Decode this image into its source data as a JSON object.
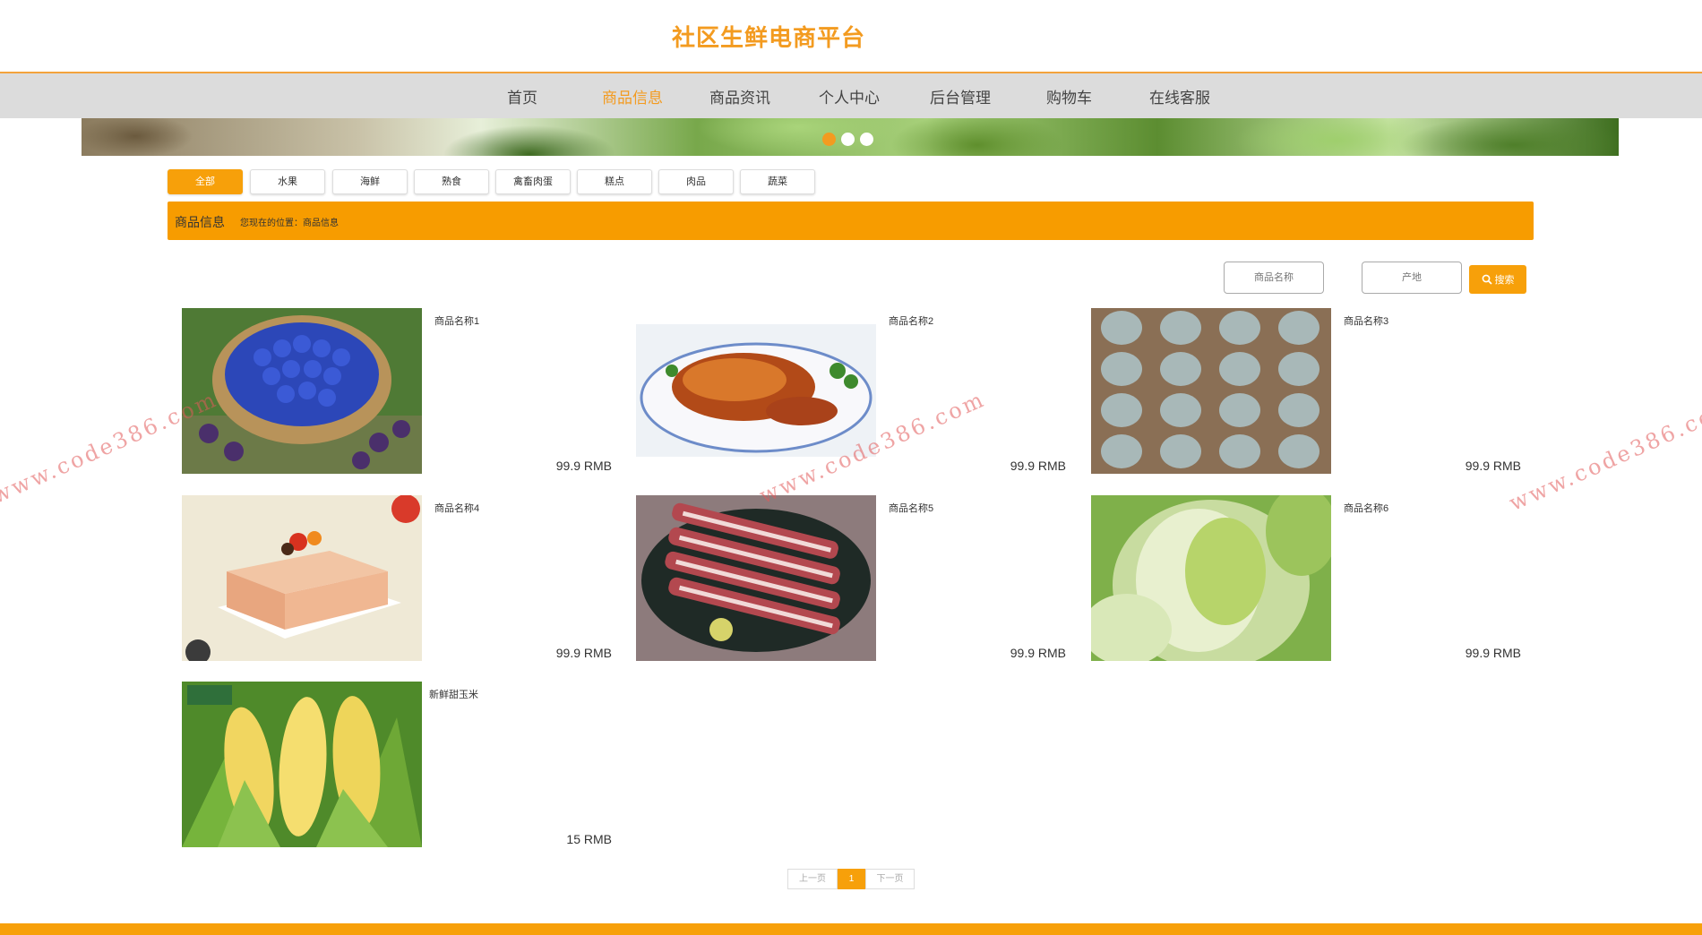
{
  "site": {
    "title": "社区生鲜电商平台"
  },
  "nav": {
    "items": [
      "首页",
      "商品信息",
      "商品资讯",
      "个人中心",
      "后台管理",
      "购物车",
      "在线客服"
    ],
    "active_index": 1
  },
  "banner": {
    "dots": 3,
    "active_dot": 0
  },
  "categories": {
    "items": [
      "全部",
      "水果",
      "海鲜",
      "熟食",
      "禽畜肉蛋",
      "糕点",
      "肉品",
      "蔬菜"
    ],
    "active_index": 0
  },
  "breadcrumb": {
    "title": "商品信息",
    "location": "您现在的位置：商品信息"
  },
  "search": {
    "name_placeholder": "商品名称",
    "origin_placeholder": "产地",
    "button_label": "搜索"
  },
  "products": [
    {
      "name": "商品名称1",
      "price": "99.9 RMB",
      "image": "blue-plums-basket"
    },
    {
      "name": "商品名称2",
      "price": "99.9 RMB",
      "image": "roast-duck"
    },
    {
      "name": "商品名称3",
      "price": "99.9 RMB",
      "image": "eggs-tray"
    },
    {
      "name": "商品名称4",
      "price": "99.9 RMB",
      "image": "cake"
    },
    {
      "name": "商品名称5",
      "price": "99.9 RMB",
      "image": "raw-ribs"
    },
    {
      "name": "商品名称6",
      "price": "99.9 RMB",
      "image": "napa-cabbage"
    },
    {
      "name": "新鲜甜玉米",
      "price": "15 RMB",
      "image": "sweet-corn"
    }
  ],
  "pagination": {
    "prev": "上一页",
    "current": "1",
    "next": "下一页"
  },
  "watermark": "www.code386.com",
  "colors": {
    "accent": "#f79c00",
    "nav_bg": "#dcdcdc"
  }
}
